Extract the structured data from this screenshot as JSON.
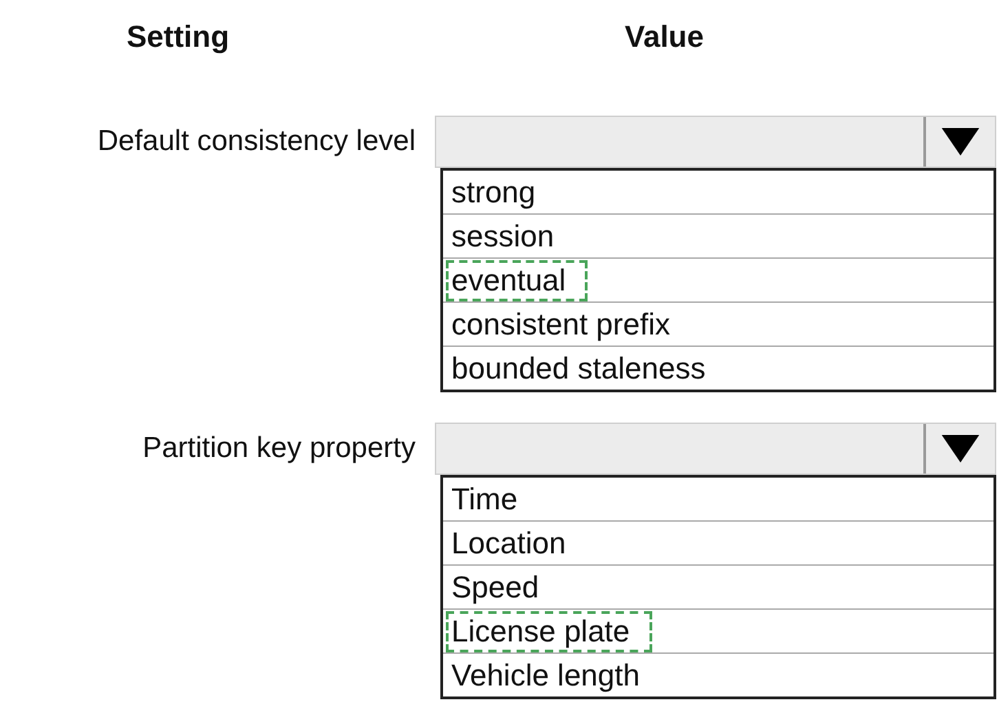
{
  "headers": [
    "Setting",
    "Value"
  ],
  "settings": [
    {
      "label": "Default consistency level",
      "options": [
        {
          "label": "strong",
          "selected": false
        },
        {
          "label": "session",
          "selected": false
        },
        {
          "label": "eventual",
          "selected": true
        },
        {
          "label": "consistent prefix",
          "selected": false
        },
        {
          "label": "bounded staleness",
          "selected": false
        }
      ]
    },
    {
      "label": "Partition key property",
      "options": [
        {
          "label": "Time",
          "selected": false
        },
        {
          "label": "Location",
          "selected": false
        },
        {
          "label": "Speed",
          "selected": false
        },
        {
          "label": "License plate",
          "selected": true
        },
        {
          "label": "Vehicle length",
          "selected": false
        }
      ]
    }
  ]
}
